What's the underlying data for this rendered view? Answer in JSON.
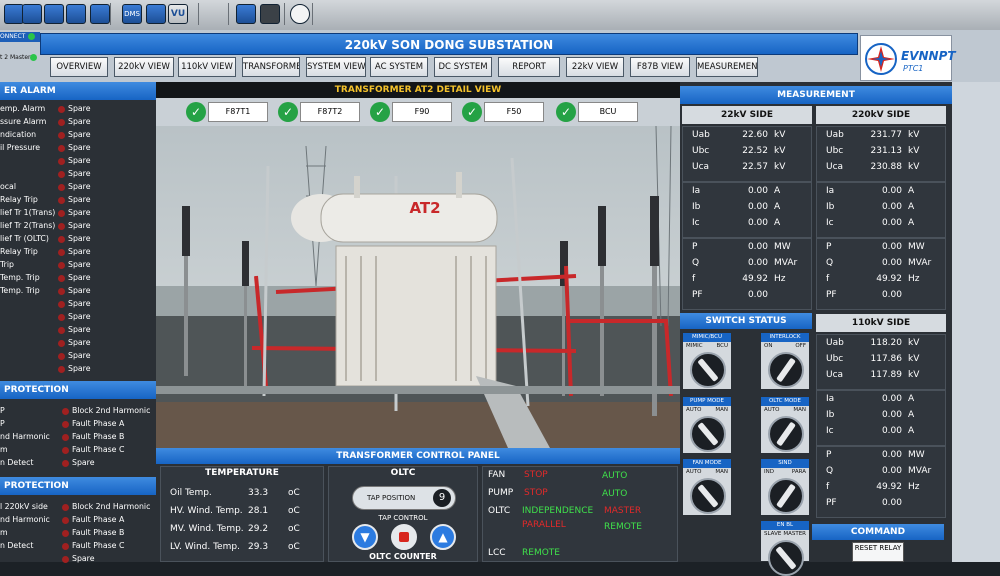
{
  "toolbar": {
    "icons": [
      "network-icon",
      "search-icon",
      "monitor-icon",
      "report-icon",
      "one-line-icon",
      "dms-icon",
      "trend-icon",
      "vu-icon",
      "topology-icon",
      "stop-icon",
      "clock-icon"
    ],
    "labels": {
      "dms": "DMS",
      "vu": "VU",
      "one": "ON",
      "d3": "3D"
    }
  },
  "conn": {
    "line1": "ONNECT",
    "line2": "t 2 Master"
  },
  "header": {
    "title": "220kV SON DONG SUBSTATION"
  },
  "nav": [
    "OVERVIEW",
    "220kV VIEW",
    "110kV VIEW",
    "TRANSFORMER",
    "SYSTEM VIEW",
    "AC SYSTEM",
    "DC SYSTEM",
    "REPORT",
    "22kV VIEW",
    "F87B VIEW",
    "MEASUREMENT"
  ],
  "logo": {
    "brand": "EVNNPT",
    "sub": "PTC1"
  },
  "left": {
    "alarm_head": "ER ALARM",
    "alarms": [
      "emp. Alarm",
      "ssure Alarm",
      "ndication",
      "il Pressure",
      "",
      "",
      "ocal",
      " Relay Trip",
      "lief Tr 1(Trans)",
      "lief Tr 2(Trans)",
      "lief Tr (OLTC)",
      "Relay Trip",
      " Trip",
      " Temp. Trip",
      " Temp. Trip",
      "",
      "",
      "",
      "",
      "",
      ""
    ],
    "alarm_values": [
      "Spare",
      "Spare",
      "Spare",
      "Spare",
      "Spare",
      "Spare",
      "Spare",
      "Spare",
      "Spare",
      "Spare",
      "Spare",
      "Spare",
      "Spare",
      "Spare",
      "Spare",
      "Spare",
      "Spare",
      "Spare",
      "Spare",
      "Spare",
      "Spare"
    ],
    "prot1_head": " PROTECTION",
    "prot1": [
      "P",
      "P",
      "nd Harmonic",
      "m",
      "n Detect"
    ],
    "prot1_values": [
      "Block 2nd Harmonic",
      "Fault Phase A",
      "Fault Phase B",
      "Fault Phase C",
      "Spare"
    ],
    "prot2_head": " PROTECTION",
    "prot2": [
      "l 220kV side",
      "nd Harmonic",
      "m",
      "n Detect",
      ""
    ],
    "prot2_values": [
      "Block 2nd Harmonic",
      "Fault Phase A",
      "Fault Phase B",
      "Fault Phase C",
      "Spare"
    ]
  },
  "camera": {
    "title": "TRANSFORMER AT2 DETAIL VIEW",
    "chips": [
      "F87T1",
      "F87T2",
      "F90",
      "F50",
      "BCU"
    ],
    "label": "AT2"
  },
  "control": {
    "title": "TRANSFORMER CONTROL PANEL",
    "temp_head": "TEMPERATURE",
    "temps": [
      {
        "label": "Oil Temp.",
        "value": "33.3",
        "unit": "oC"
      },
      {
        "label": "HV. Wind. Temp.",
        "value": "28.1",
        "unit": "oC"
      },
      {
        "label": "MV. Wind. Temp.",
        "value": "29.2",
        "unit": "oC"
      },
      {
        "label": "LV. Wind. Temp.",
        "value": "29.3",
        "unit": "oC"
      }
    ],
    "oltc_head": "OLTC",
    "tap_label": "TAP POSITION",
    "tap_value": "9",
    "tap_control": "TAP CONTROL",
    "oltc_counter": "OLTC COUNTER",
    "fan_label": "FAN",
    "fan_state": "STOP",
    "fan_mode": "AUTO",
    "pump_label": "PUMP",
    "pump_state": "STOP",
    "pump_mode": "AUTO",
    "oltc_label": "OLTC",
    "oltc_mode1": "INDEPENDENCE",
    "oltc_mode2": "MASTER",
    "oltc_mode3": "PARALLEL",
    "oltc_mode4": "REMOTE",
    "lcc_label": "LCC",
    "lcc_mode": "REMOTE"
  },
  "measurement": {
    "head": "MEASUREMENT",
    "s22": {
      "head": "22kV SIDE",
      "v": [
        [
          "Uab",
          "22.60",
          "kV"
        ],
        [
          "Ubc",
          "22.52",
          "kV"
        ],
        [
          "Uca",
          "22.57",
          "kV"
        ]
      ],
      "i": [
        [
          "Ia",
          "0.00",
          "A"
        ],
        [
          "Ib",
          "0.00",
          "A"
        ],
        [
          "Ic",
          "0.00",
          "A"
        ]
      ],
      "p": [
        [
          "P",
          "0.00",
          "MW"
        ],
        [
          "Q",
          "0.00",
          "MVAr"
        ],
        [
          "f",
          "49.92",
          "Hz"
        ],
        [
          "PF",
          "0.00",
          ""
        ]
      ]
    },
    "s220": {
      "head": "220kV SIDE",
      "v": [
        [
          "Uab",
          "231.77",
          "kV"
        ],
        [
          "Ubc",
          "231.13",
          "kV"
        ],
        [
          "Uca",
          "230.88",
          "kV"
        ]
      ],
      "i": [
        [
          "Ia",
          "0.00",
          "A"
        ],
        [
          "Ib",
          "0.00",
          "A"
        ],
        [
          "Ic",
          "0.00",
          "A"
        ]
      ],
      "p": [
        [
          "P",
          "0.00",
          "MW"
        ],
        [
          "Q",
          "0.00",
          "MVAr"
        ],
        [
          "f",
          "49.92",
          "Hz"
        ],
        [
          "PF",
          "0.00",
          ""
        ]
      ]
    },
    "s110": {
      "head": "110kV SIDE",
      "v": [
        [
          "Uab",
          "118.20",
          "kV"
        ],
        [
          "Ubc",
          "117.86",
          "kV"
        ],
        [
          "Uca",
          "117.89",
          "kV"
        ]
      ],
      "i": [
        [
          "Ia",
          "0.00",
          "A"
        ],
        [
          "Ib",
          "0.00",
          "A"
        ],
        [
          "Ic",
          "0.00",
          "A"
        ]
      ],
      "p": [
        [
          "P",
          "0.00",
          "MW"
        ],
        [
          "Q",
          "0.00",
          "MVAr"
        ],
        [
          "f",
          "49.92",
          "Hz"
        ],
        [
          "PF",
          "0.00",
          ""
        ]
      ]
    }
  },
  "switch": {
    "head": "SWITCH STATUS",
    "items": [
      {
        "label": "MIMIC/BCU",
        "left": "MIMIC",
        "right": "BCU"
      },
      {
        "label": "INTERLOCK",
        "left": "ON",
        "right": "OFF"
      },
      {
        "label": "PUMP MODE",
        "left": "AUTO",
        "right": "MAN"
      },
      {
        "label": "OLTC MODE",
        "left": "AUTO",
        "right": "MAN"
      },
      {
        "label": "FAN MODE",
        "left": "AUTO",
        "right": "MAN"
      },
      {
        "label": "SIND",
        "left": "IND",
        "right": "PARA"
      },
      {
        "label": "EN BL",
        "left": "SLAVE",
        "right": "MASTER"
      }
    ]
  },
  "command": {
    "head": "COMMAND",
    "reset": "RESET RELAY"
  },
  "colors": {
    "accent": "#1764c4",
    "ok": "#25a245",
    "alarm": "#e12a2a",
    "mode": "#3fe04b"
  }
}
